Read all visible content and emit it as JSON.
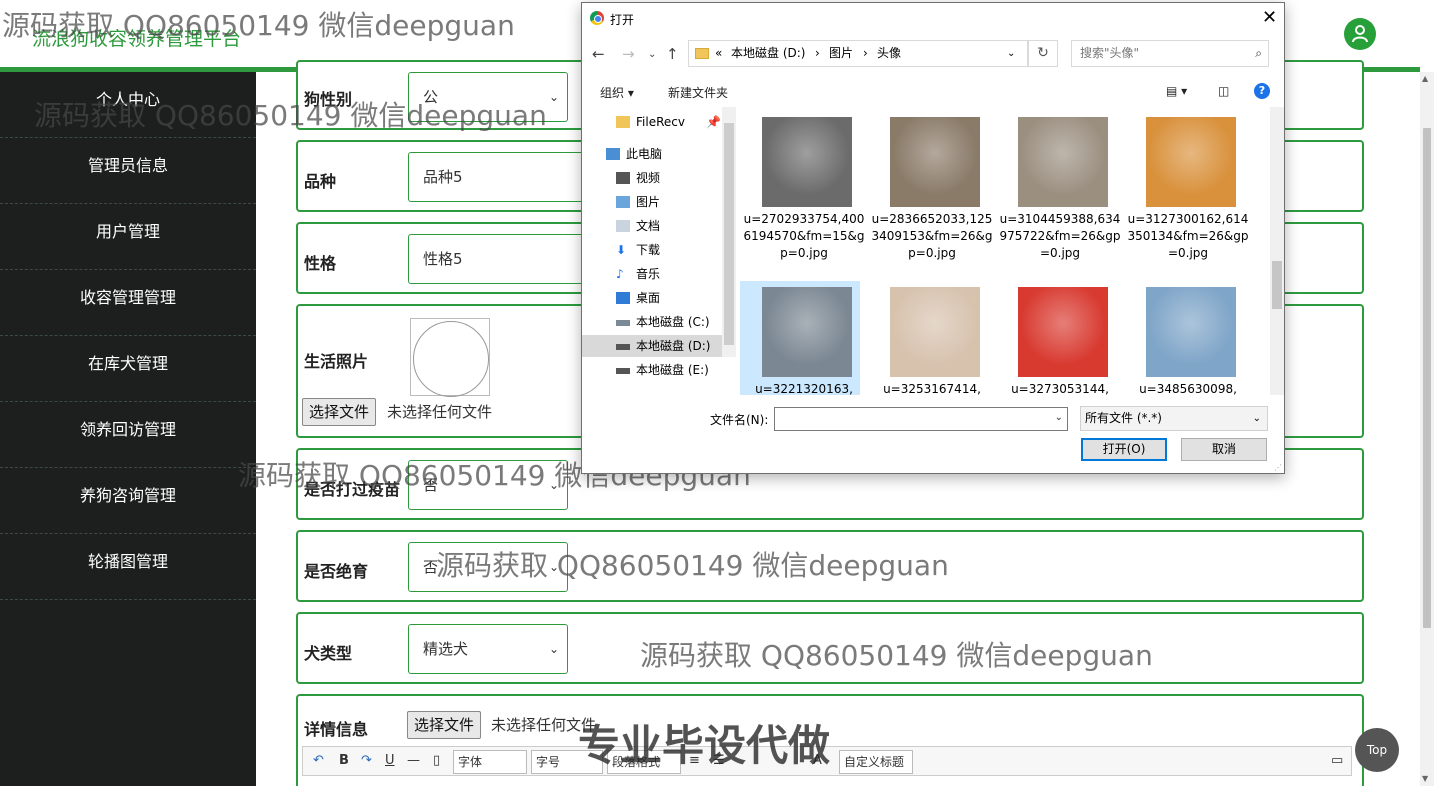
{
  "header": {
    "title": "流浪狗收容领养管理平台"
  },
  "sidebar": {
    "items": [
      {
        "label": "个人中心"
      },
      {
        "label": "管理员信息"
      },
      {
        "label": "用户管理"
      },
      {
        "label": "收容管理管理"
      },
      {
        "label": "在库犬管理"
      },
      {
        "label": "领养回访管理"
      },
      {
        "label": "养狗咨询管理"
      },
      {
        "label": "轮播图管理"
      }
    ]
  },
  "form": {
    "gender": {
      "label": "狗性别",
      "value": "公"
    },
    "breed": {
      "label": "品种",
      "value": "品种5"
    },
    "temper": {
      "label": "性格",
      "value": "性格5"
    },
    "photo": {
      "label": "生活照片",
      "button": "选择文件",
      "note": "未选择任何文件"
    },
    "vaccinated": {
      "label": "是否打过疫苗",
      "value": "否"
    },
    "sterilized": {
      "label": "是否绝育",
      "value": "否"
    },
    "dog_type": {
      "label": "犬类型",
      "value": "精选犬"
    },
    "details": {
      "label": "详情信息",
      "button": "选择文件",
      "note": "未选择任何文件"
    }
  },
  "editor": {
    "bold": "B",
    "underline": "U",
    "font_select": "字体",
    "size_select": "字号",
    "paragraph_select": "段落格式",
    "title_select": "自定义标题"
  },
  "back_to_top": "Top",
  "watermark": {
    "text": "源码获取 QQ86050149 微信deepguan",
    "big": "专业毕设代做"
  },
  "dialog": {
    "title": "打开",
    "path": [
      "«",
      "本地磁盘 (D:)",
      "›",
      "图片",
      "›",
      "头像"
    ],
    "search_placeholder": "搜索\"头像\"",
    "organize": "组织 ▾",
    "new_folder": "新建文件夹",
    "tree": [
      {
        "label": "FileRecv",
        "icon": "folder-icon"
      },
      {
        "label": "此电脑",
        "icon": "computer-icon"
      },
      {
        "label": "视频",
        "icon": "video-icon"
      },
      {
        "label": "图片",
        "icon": "picture-icon"
      },
      {
        "label": "文档",
        "icon": "document-icon"
      },
      {
        "label": "下载",
        "icon": "download-icon"
      },
      {
        "label": "音乐",
        "icon": "music-icon"
      },
      {
        "label": "桌面",
        "icon": "desktop-icon"
      },
      {
        "label": "本地磁盘 (C:)",
        "icon": "drive-icon"
      },
      {
        "label": "本地磁盘 (D:)",
        "icon": "drive-icon"
      },
      {
        "label": "本地磁盘 (E:)",
        "icon": "drive-icon"
      }
    ],
    "files": [
      {
        "name": "u=2702933754,4006194570&fm=15&gp=0.jpg",
        "color": "#6b6b6b"
      },
      {
        "name": "u=2836652033,1253409153&fm=26&gp=0.jpg",
        "color": "#8a7a68"
      },
      {
        "name": "u=3104459388,634975722&fm=26&gp=0.jpg",
        "color": "#9b8f80"
      },
      {
        "name": "u=3127300162,614350134&fm=26&gp=0.jpg",
        "color": "#d9913c"
      },
      {
        "name": "u=3221320163,",
        "color": "#7b8792"
      },
      {
        "name": "u=3253167414,",
        "color": "#d7c2ae"
      },
      {
        "name": "u=3273053144,",
        "color": "#d83a30"
      },
      {
        "name": "u=3485630098,",
        "color": "#7fa5c8"
      }
    ],
    "filename_label": "文件名(N):",
    "filename_value": "",
    "filetype": "所有文件 (*.*)",
    "open_button": "打开(O)",
    "cancel_button": "取消"
  }
}
